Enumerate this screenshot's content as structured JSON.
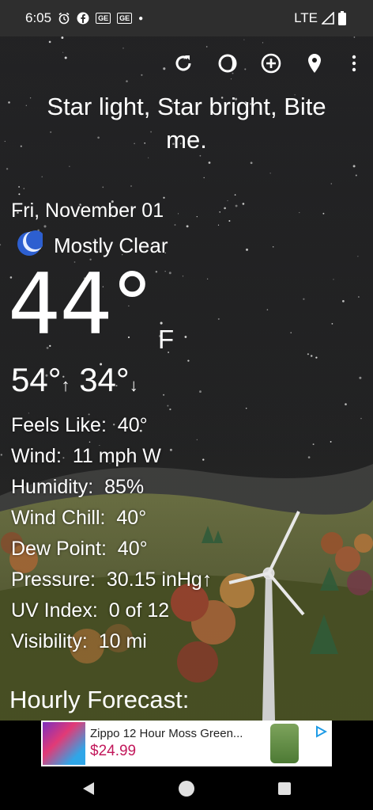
{
  "status_bar": {
    "time": "6:05",
    "icons": [
      "alarm-icon",
      "facebook-icon",
      "news-icon",
      "news-icon",
      "dot"
    ],
    "network": "LTE",
    "right_icons": [
      "signal-icon",
      "battery-icon"
    ]
  },
  "toolbar": {
    "icons": [
      "refresh-icon",
      "moon-phase-icon",
      "add-icon",
      "location-icon",
      "more-icon"
    ]
  },
  "headline": "Star light, Star bright, Bite me.",
  "weather": {
    "date": "Fri, November 01",
    "condition_icon": "moon-icon",
    "condition": "Mostly Clear",
    "temperature": "44°",
    "unit": "F",
    "high": "54°",
    "low": "34°",
    "high_arrow": "↑",
    "low_arrow": "↓"
  },
  "details": [
    {
      "label": "Feels Like:",
      "value": "40°"
    },
    {
      "label": "Wind:",
      "value": "11 mph W"
    },
    {
      "label": "Humidity:",
      "value": "85%"
    },
    {
      "label": "Wind Chill:",
      "value": "40°"
    },
    {
      "label": "Dew Point:",
      "value": "40°"
    },
    {
      "label": "Pressure:",
      "value": "30.15 inHg↑"
    },
    {
      "label": "UV Index:",
      "value": "0 of 12"
    },
    {
      "label": "Visibility:",
      "value": "10 mi"
    }
  ],
  "hourly_title": "Hourly Forecast:",
  "ad": {
    "title": "Zippo 12 Hour Moss Green...",
    "price": "$24.99",
    "choice_icon": "adchoices-icon"
  },
  "nav": {
    "icons": [
      "back-icon",
      "home-icon",
      "recents-icon"
    ]
  },
  "colors": {
    "statusbar": "#2e2e2e",
    "sky": "#19191b",
    "ad_price": "#c2185b",
    "moon": "#2d5fd0"
  }
}
